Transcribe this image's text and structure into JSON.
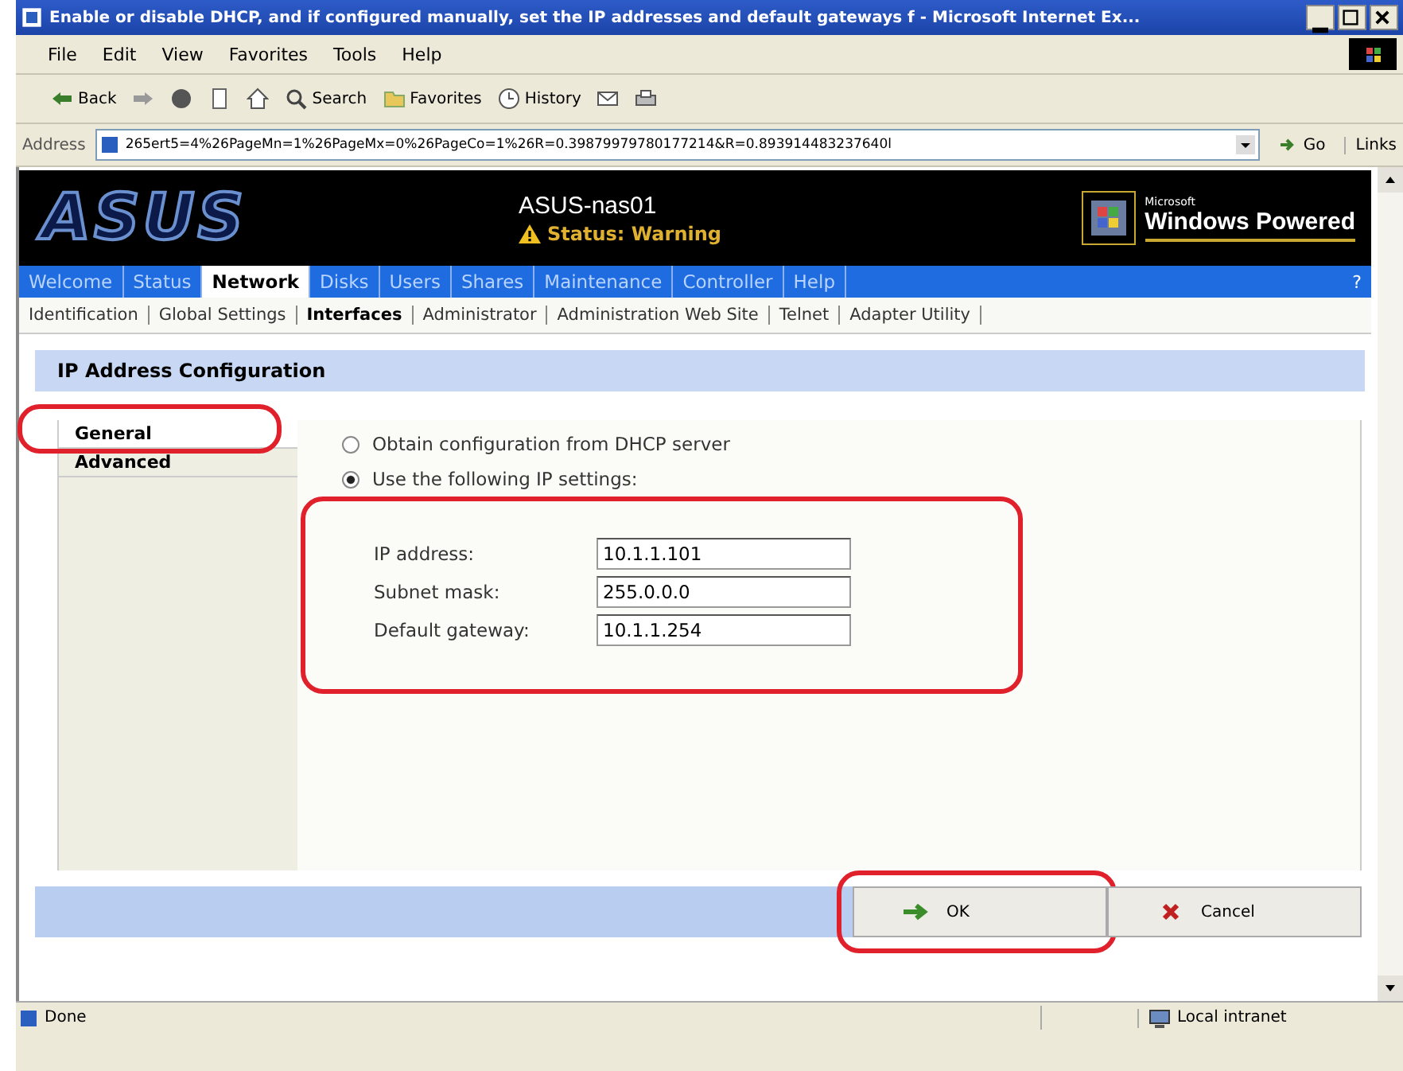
{
  "window": {
    "title": "Enable or disable DHCP, and if configured manually, set the IP addresses and default gateways f - Microsoft Internet Ex..."
  },
  "menu": [
    "File",
    "Edit",
    "View",
    "Favorites",
    "Tools",
    "Help"
  ],
  "toolbar": [
    {
      "kind": "back",
      "label": "Back"
    },
    {
      "kind": "forward"
    },
    {
      "kind": "stop"
    },
    {
      "kind": "refresh"
    },
    {
      "kind": "home"
    },
    {
      "kind": "search",
      "label": "Search"
    },
    {
      "kind": "favorites",
      "label": "Favorites"
    },
    {
      "kind": "history",
      "label": "History"
    },
    {
      "kind": "mail"
    },
    {
      "kind": "print"
    }
  ],
  "address": {
    "label": "Address",
    "value": "265ert5=4%26PageMn=1%26PageMx=0%26PageCo=1%26R=0.39879979780177214&R=0.893914483237640l",
    "go": "Go",
    "links": "Links"
  },
  "header": {
    "logo": "ASUS",
    "device": "ASUS-nas01",
    "status": "Status: Warning",
    "badge_small": "Microsoft",
    "badge": "Windows Powered"
  },
  "nav": [
    {
      "label": "Welcome",
      "selected": false
    },
    {
      "label": "Status",
      "selected": false
    },
    {
      "label": "Network",
      "selected": true
    },
    {
      "label": "Disks",
      "selected": false
    },
    {
      "label": "Users",
      "selected": false
    },
    {
      "label": "Shares",
      "selected": false
    },
    {
      "label": "Maintenance",
      "selected": false
    },
    {
      "label": "Controller",
      "selected": false
    },
    {
      "label": "Help",
      "selected": false
    }
  ],
  "help_mark": "?",
  "subnav": [
    {
      "label": "Identification",
      "selected": false
    },
    {
      "label": "Global Settings",
      "selected": false
    },
    {
      "label": "Interfaces",
      "selected": true
    },
    {
      "label": "Administrator",
      "selected": false
    },
    {
      "label": "Administration Web Site",
      "selected": false
    },
    {
      "label": "Telnet",
      "selected": false
    },
    {
      "label": "Adapter Utility",
      "selected": false
    }
  ],
  "section_title": "IP Address Configuration",
  "side_tabs": [
    {
      "label": "General",
      "selected": true,
      "highlighted": true
    },
    {
      "label": "Advanced",
      "selected": false,
      "highlighted": false
    }
  ],
  "radios": [
    {
      "label": "Obtain configuration from DHCP server",
      "selected": false,
      "highlighted": false
    },
    {
      "label": "Use the following IP settings:",
      "selected": true,
      "highlighted": true
    }
  ],
  "fields": [
    {
      "label": "IP address:",
      "value": "10.1.1.101"
    },
    {
      "label": "Subnet mask:",
      "value": "255.0.0.0"
    },
    {
      "label": "Default gateway:",
      "value": "10.1.1.254"
    }
  ],
  "buttons": [
    {
      "kind": "ok",
      "label": "OK",
      "highlighted": true
    },
    {
      "kind": "cancel",
      "label": "Cancel",
      "highlighted": false
    }
  ],
  "status_bar": {
    "text": "Done",
    "zone": "Local intranet"
  }
}
